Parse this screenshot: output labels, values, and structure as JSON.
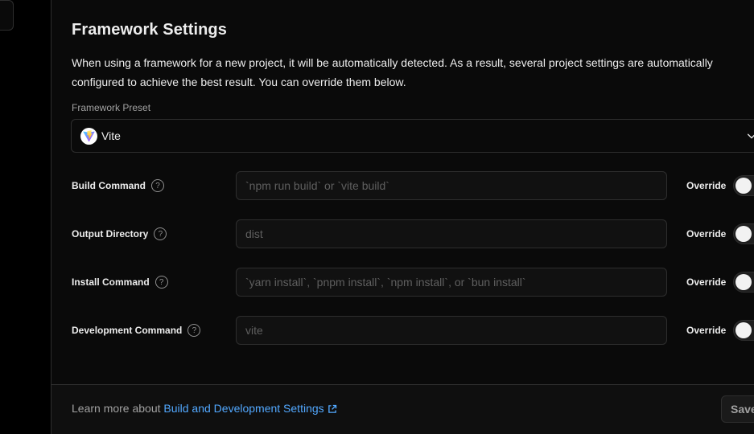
{
  "framework_settings": {
    "title": "Framework Settings",
    "description": "When using a framework for a new project, it will be automatically detected. As a result, several project settings are automatically configured to achieve the best result. You can override them below.",
    "preset_label": "Framework Preset",
    "preset_value": "Vite"
  },
  "rows": [
    {
      "label": "Build Command",
      "placeholder": "`npm run build` or `vite build`",
      "override_label": "Override",
      "override_on": false
    },
    {
      "label": "Output Directory",
      "placeholder": "dist",
      "override_label": "Override",
      "override_on": false
    },
    {
      "label": "Install Command",
      "placeholder": "`yarn install`, `pnpm install`, `npm install`, or `bun install`",
      "override_label": "Override",
      "override_on": false
    },
    {
      "label": "Development Command",
      "placeholder": "vite",
      "override_label": "Override",
      "override_on": false
    }
  ],
  "footer": {
    "prefix": "Learn more about",
    "link_text": "Build and Development Settings",
    "save_label": "Save"
  },
  "icons": {
    "help": "help-circle-icon",
    "chevron": "chevron-down-icon",
    "external": "external-link-icon",
    "framework_logo": "vite-logo-icon"
  },
  "colors": {
    "background": "#0a0a0a",
    "border": "#2e2e2e",
    "link": "#52a8ff",
    "text": "#ededed",
    "muted": "#a1a1a1"
  }
}
